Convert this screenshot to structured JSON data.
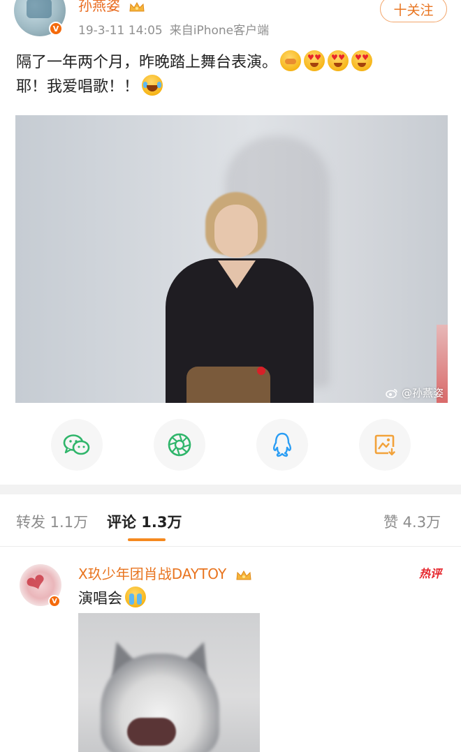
{
  "post": {
    "username": "孙燕姿",
    "verified_badge": "V",
    "date": "19-3-11 14:05",
    "source": "来自iPhone客户端",
    "follow_label": "十关注",
    "text_line1": "隔了一年两个月，昨晚踏上舞台表演。",
    "text_line2": "耶！我爱唱歌！！",
    "photo_watermark": "@孙燕姿",
    "icons": [
      "crown-icon",
      "shy-emoji",
      "heart-eyes-emoji",
      "laugh-cry-emoji"
    ]
  },
  "share": {
    "icons": [
      "wechat-icon",
      "moments-icon",
      "qq-icon",
      "save-image-icon"
    ]
  },
  "tabs": {
    "repost": "转发 1.1万",
    "comments": "评论 1.3万",
    "likes": "赞 4.3万"
  },
  "comment": {
    "username": "X玖少年团肖战DAYTOY",
    "verified_badge": "V",
    "hot_tag": "热评",
    "text": "演唱会",
    "icons": [
      "crown-icon",
      "crying-emoji"
    ]
  },
  "colors": {
    "accent_orange": "#e8741f",
    "verified_orange": "#f46a0c",
    "hot_red": "#e6262d",
    "wechat_green": "#2fb56a",
    "qq_blue": "#2a9df4",
    "save_orange": "#f2a23a"
  }
}
